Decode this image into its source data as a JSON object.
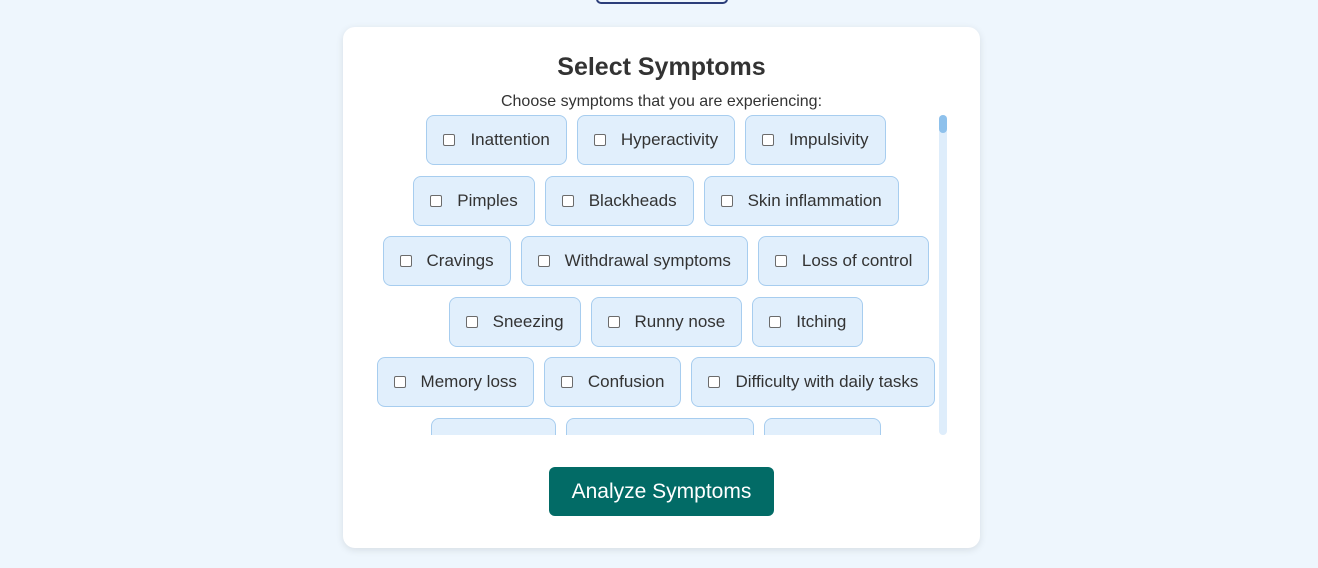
{
  "header": {
    "title": "Select Symptoms",
    "subtitle": "Choose symptoms that you are experiencing:"
  },
  "symptom_rows": [
    [
      {
        "label": "Inattention",
        "checked": false
      },
      {
        "label": "Hyperactivity",
        "checked": false
      },
      {
        "label": "Impulsivity",
        "checked": false
      }
    ],
    [
      {
        "label": "Pimples",
        "checked": false
      },
      {
        "label": "Blackheads",
        "checked": false
      },
      {
        "label": "Skin inflammation",
        "checked": false
      }
    ],
    [
      {
        "label": "Cravings",
        "checked": false
      },
      {
        "label": "Withdrawal symptoms",
        "checked": false
      },
      {
        "label": "Loss of control",
        "checked": false
      }
    ],
    [
      {
        "label": "Sneezing",
        "checked": false
      },
      {
        "label": "Runny nose",
        "checked": false
      },
      {
        "label": "Itching",
        "checked": false
      }
    ],
    [
      {
        "label": "Memory loss",
        "checked": false
      },
      {
        "label": "Confusion",
        "checked": false
      },
      {
        "label": "Difficulty with daily tasks",
        "checked": false
      }
    ]
  ],
  "analyze_button": {
    "label": "Analyze Symptoms"
  },
  "colors": {
    "page_background": "#eef6fd",
    "chip_background": "#e1effc",
    "chip_border": "#a7cdef",
    "button_background": "#026b66",
    "scroll_thumb": "#8ec1ec"
  }
}
